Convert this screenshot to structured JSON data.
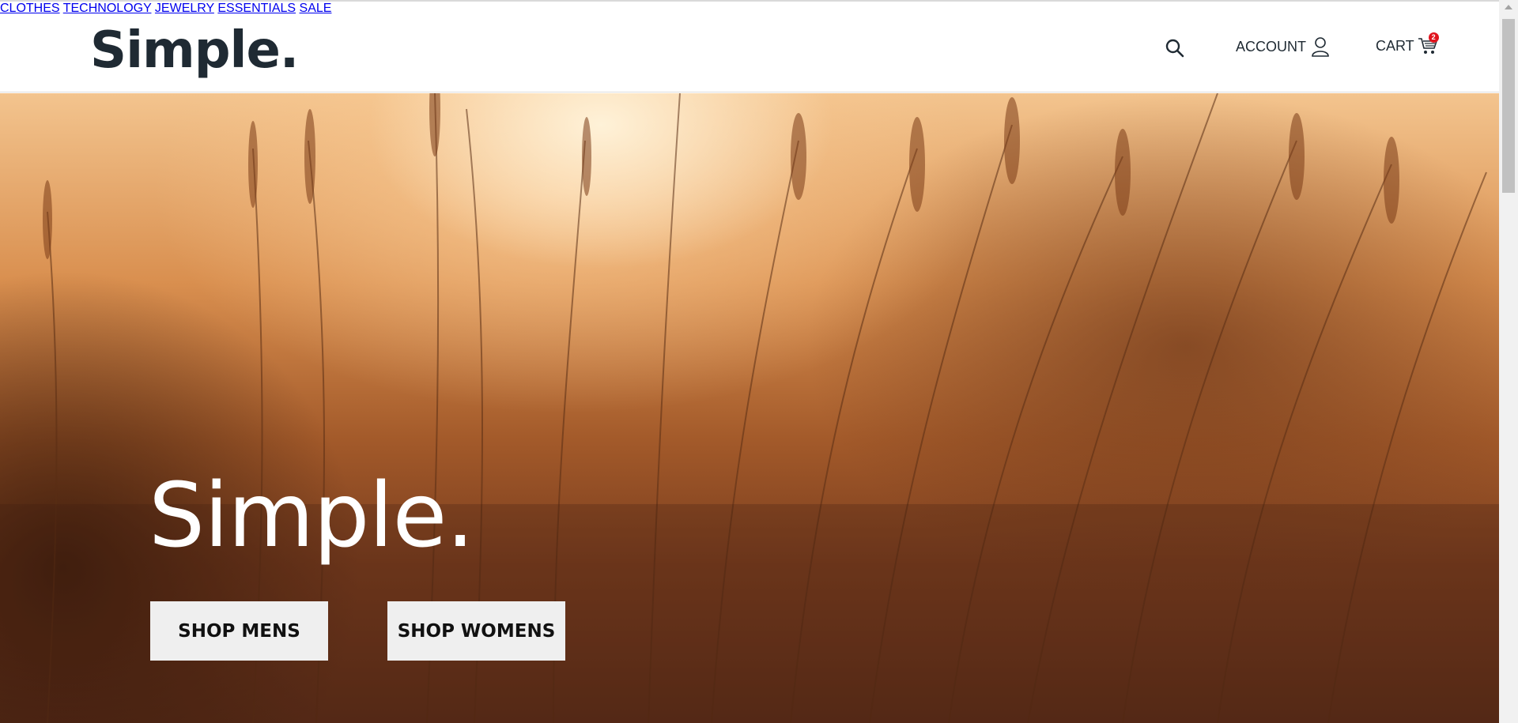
{
  "header": {
    "logo": "Simple.",
    "nav": [
      "CLOTHES",
      "TECHNOLOGY",
      "JEWELRY",
      "ESSENTIALS",
      "SALE"
    ],
    "account_label": "ACCOUNT",
    "cart_label": "CART",
    "cart_count": "2"
  },
  "hero": {
    "title": "Simple.",
    "shop_mens": "SHOP MENS",
    "shop_womens": "SHOP WOMENS"
  },
  "colors": {
    "text_dark": "#1f2a33",
    "badge": "#e0141e",
    "button_bg": "#efefef"
  },
  "icons": [
    "search-icon",
    "user-icon",
    "cart-icon"
  ]
}
